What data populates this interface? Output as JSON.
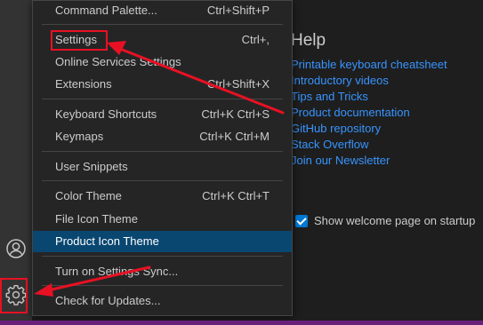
{
  "menu": {
    "items": [
      {
        "label": "Command Palette...",
        "shortcut": "Ctrl+Shift+P"
      },
      {
        "label": "Settings",
        "shortcut": "Ctrl+,"
      },
      {
        "label": "Online Services Settings",
        "shortcut": ""
      },
      {
        "label": "Extensions",
        "shortcut": "Ctrl+Shift+X"
      },
      {
        "label": "Keyboard Shortcuts",
        "shortcut": "Ctrl+K Ctrl+S"
      },
      {
        "label": "Keymaps",
        "shortcut": "Ctrl+K Ctrl+M"
      },
      {
        "label": "User Snippets",
        "shortcut": ""
      },
      {
        "label": "Color Theme",
        "shortcut": "Ctrl+K Ctrl+T"
      },
      {
        "label": "File Icon Theme",
        "shortcut": ""
      },
      {
        "label": "Product Icon Theme",
        "shortcut": ""
      },
      {
        "label": "Turn on Settings Sync...",
        "shortcut": ""
      },
      {
        "label": "Check for Updates...",
        "shortcut": ""
      }
    ]
  },
  "welcome": {
    "help_title": "Help",
    "links": [
      "Printable keyboard cheatsheet",
      "Introductory videos",
      "Tips and Tricks",
      "Product documentation",
      "GitHub repository",
      "Stack Overflow",
      "Join our Newsletter"
    ],
    "show_on_startup_label": "Show welcome page on startup",
    "show_on_startup_checked": true
  },
  "icons": {
    "account": "account-icon",
    "manage": "gear-icon"
  },
  "colors": {
    "menu_bg": "#252526",
    "active_item": "#094771",
    "link": "#3794ff",
    "annotation": "#e81123",
    "status_bar": "#68217a"
  }
}
